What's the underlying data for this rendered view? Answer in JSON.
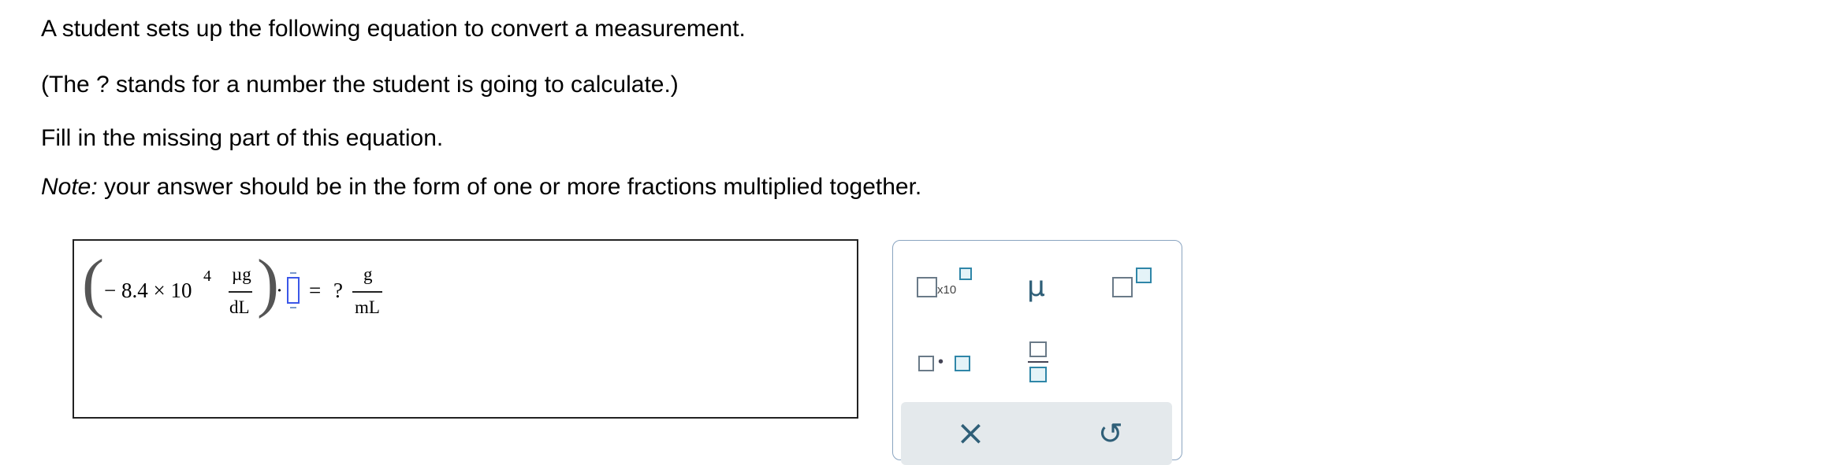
{
  "question": {
    "line1": "A student sets up the following equation to convert a measurement.",
    "line2": "(The ? stands for a number the student is going to calculate.)",
    "line3": "Fill in the missing part of this equation.",
    "note_label": "Note:",
    "note_text": " your answer should be in the form of one or more fractions multiplied together."
  },
  "equation": {
    "coefficient": "− 8.4  ×  10",
    "exponent": "4",
    "unit_num": "µg",
    "unit_den": "dL",
    "dot": "·",
    "equals": "=",
    "unknown": "?",
    "result_num": "g",
    "result_den": "mL"
  },
  "palette": {
    "sci_notation_label": "x10",
    "mu_label": "µ",
    "times_dot": "•",
    "clear_symbol": "×",
    "undo_symbol": "↺"
  },
  "colors": {
    "accent_blue": "#2f86a8",
    "slot_blue": "#3b57e8",
    "palette_border": "#8aa4c0",
    "toolbar_bg": "#e4e9ec"
  }
}
